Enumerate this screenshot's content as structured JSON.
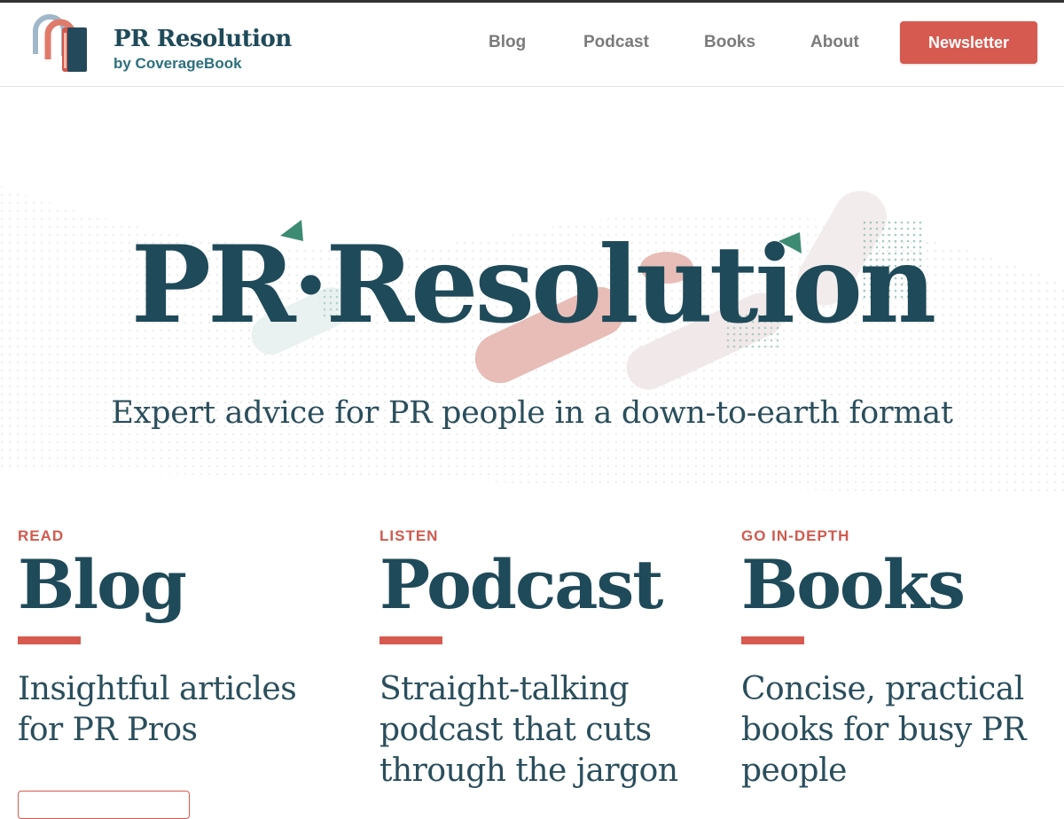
{
  "header": {
    "brand_name": "PR Resolution",
    "brand_by": "by CoverageBook",
    "nav": [
      "Blog",
      "Podcast",
      "Books",
      "About"
    ],
    "cta_label": "Newsletter"
  },
  "hero": {
    "title": "PR·Resolution",
    "subtitle": "Expert advice for PR people in a down-to-earth format"
  },
  "sections": [
    {
      "kicker": "READ",
      "title": "Blog",
      "description": "Insightful articles for PR Pros"
    },
    {
      "kicker": "LISTEN",
      "title": "Podcast",
      "description": "Straight-talking podcast that cuts through the jargon"
    },
    {
      "kicker": "GO IN-DEPTH",
      "title": "Books",
      "description": "Concise, practical books for busy PR people"
    }
  ],
  "colors": {
    "accent": "#d65a4f",
    "brand_dark": "#1f4a59",
    "teal": "#2c6f7e",
    "green_triangle": "#3d8b73"
  }
}
